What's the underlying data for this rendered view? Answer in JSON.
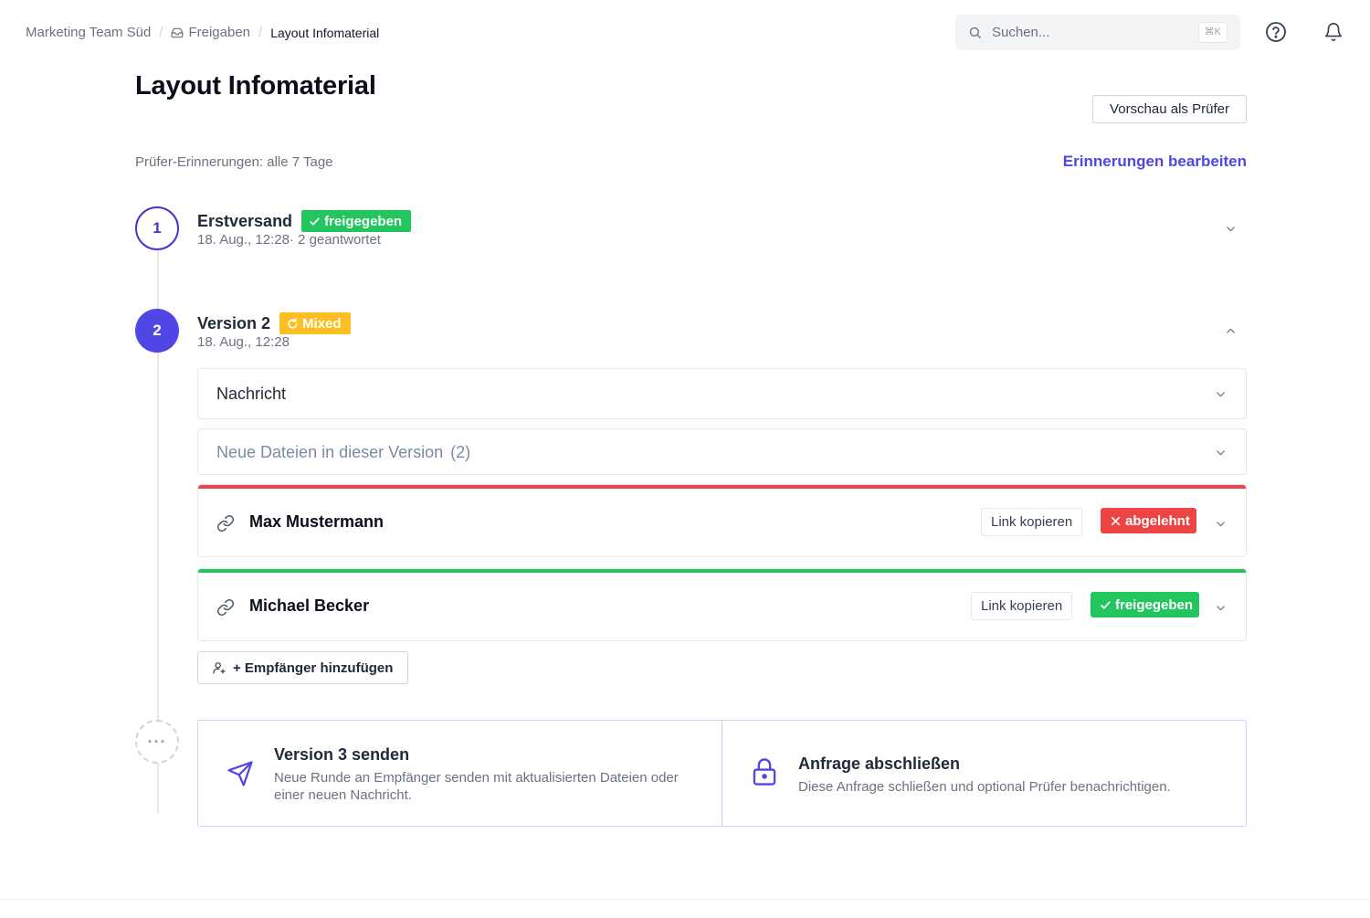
{
  "breadcrumb": {
    "team": "Marketing Team Süd",
    "section": "Freigaben",
    "current": "Layout Infomaterial"
  },
  "search": {
    "placeholder": "Suchen...",
    "shortcut": "⌘K"
  },
  "page": {
    "title": "Layout Infomaterial",
    "preview_button": "Vorschau als Prüfer",
    "reminder_text": "Prüfer-Erinnerungen: alle 7 Tage",
    "reminder_link": "Erinnerungen bearbeiten"
  },
  "steps": [
    {
      "number": "1",
      "title": "Erstversand",
      "badge": "freigegeben",
      "subtitle": "18. Aug., 12:28· 2 geantwortet"
    },
    {
      "number": "2",
      "title": "Version 2",
      "badge": "Mixed",
      "subtitle": "18. Aug., 12:28"
    }
  ],
  "sections": {
    "message_label": "Nachricht",
    "files_label": "Neue Dateien in dieser Version",
    "files_count": "(2)"
  },
  "reviewers": [
    {
      "name": "Max Mustermann",
      "copy_label": "Link kopieren",
      "status": "abgelehnt",
      "status_color": "#ef4444"
    },
    {
      "name": "Michael Becker",
      "copy_label": "Link kopieren",
      "status": "freigegeben",
      "status_color": "#22c55e"
    }
  ],
  "add_recipient": "+ Empfänger hinzufügen",
  "step3_marker": "···",
  "actions": {
    "send": {
      "title": "Version 3 senden",
      "description_line1": "Neue Runde an Empfänger senden mit aktualisierten Dateien oder",
      "description_line2": "einer neuen Nachricht."
    },
    "close": {
      "title": "Anfrage abschließen",
      "description": "Diese Anfrage schließen und optional Prüfer benachrichtigen."
    }
  },
  "colors": {
    "accent": "#4f46e5",
    "approved": "#22c55e",
    "rejected": "#ef4444",
    "mixed": "#fbbf24"
  }
}
